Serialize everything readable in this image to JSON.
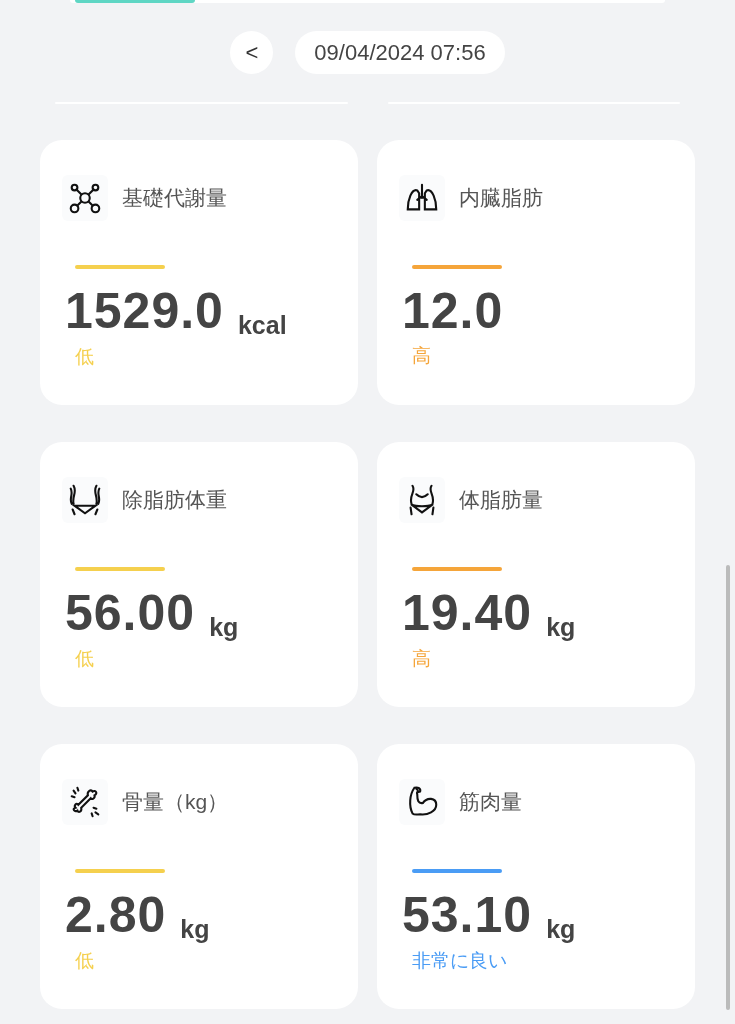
{
  "date_nav": {
    "back_button": "<",
    "datetime": "09/04/2024 07:56"
  },
  "metrics": [
    {
      "kind": "molecule",
      "title": "基礎代謝量",
      "value": "1529.0",
      "unit": "kcal",
      "status": "低",
      "color": "#f5d04e"
    },
    {
      "kind": "lungs",
      "title": "内臓脂肪",
      "value": "12.0",
      "status": "高",
      "color": "#f5a53a"
    },
    {
      "kind": "waist",
      "title": "除脂肪体重",
      "value": "56.00",
      "unit": "kg",
      "status": "低",
      "color": "#f5d04e"
    },
    {
      "kind": "belly",
      "title": "体脂肪量",
      "value": "19.40",
      "unit": "kg",
      "status": "高",
      "color": "#f5a53a"
    },
    {
      "kind": "bone",
      "title": "骨量（kg）",
      "value": "2.80",
      "unit": "kg",
      "status": "低",
      "color": "#f5d04e"
    },
    {
      "kind": "muscle",
      "title": "筋肉量",
      "value": "53.10",
      "unit": "kg",
      "status": "非常に良い",
      "color": "#4a9cf5"
    }
  ]
}
